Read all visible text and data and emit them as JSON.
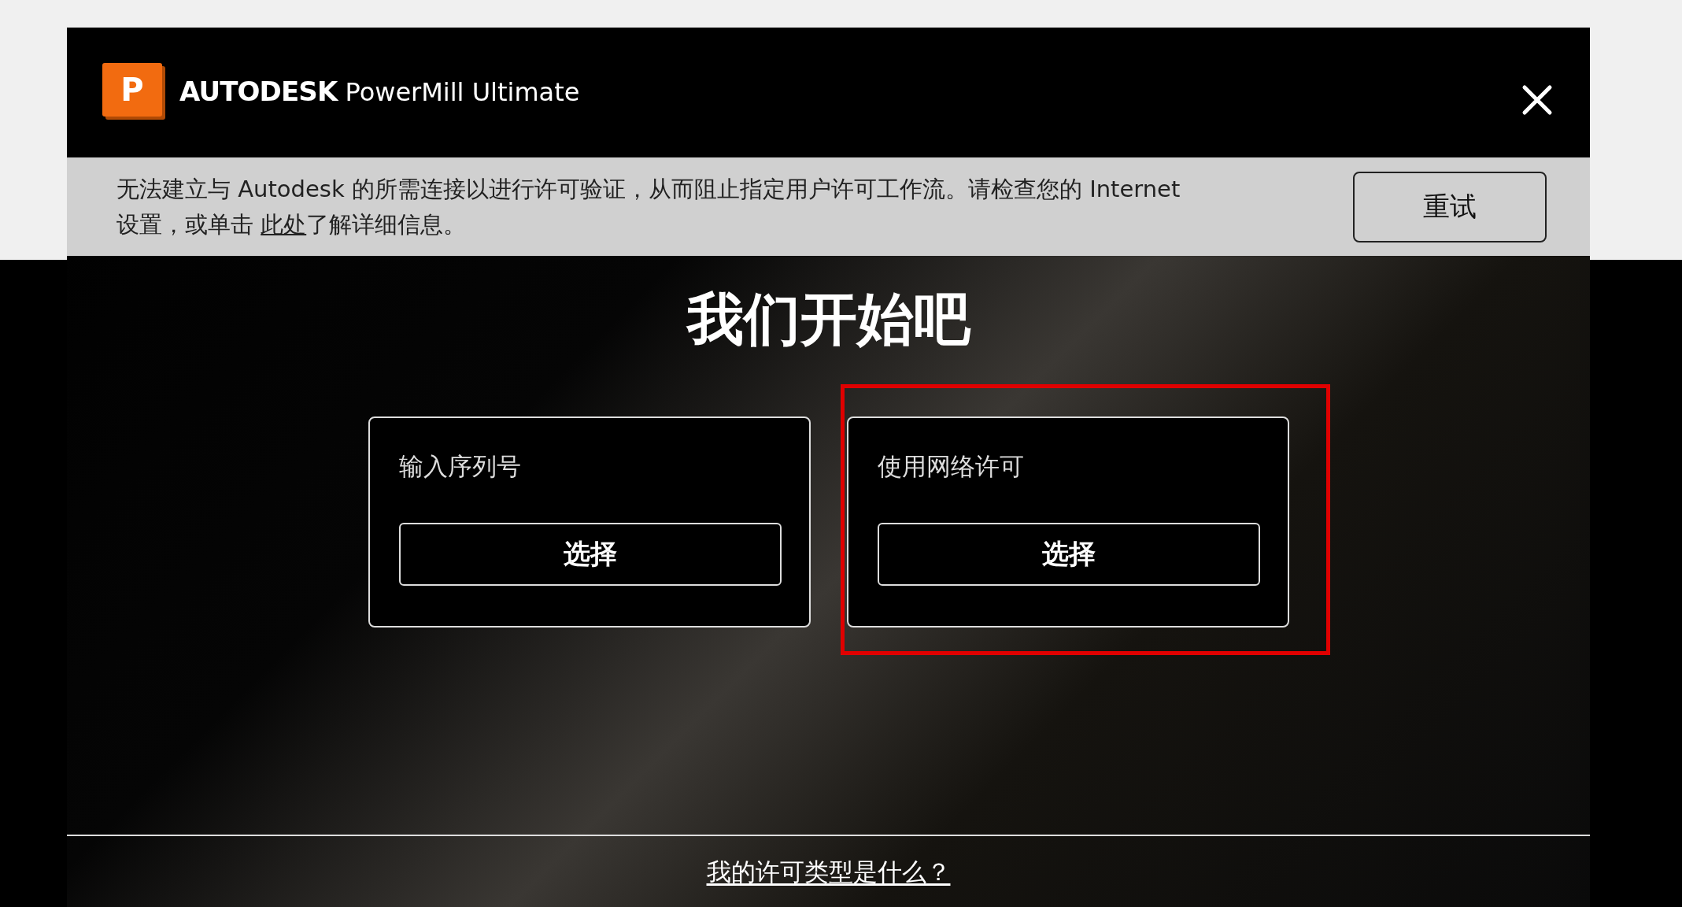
{
  "header": {
    "logo_letter": "P",
    "brand": "AUTODESK",
    "product": "PowerMill Ultimate"
  },
  "banner": {
    "message_before": "无法建立与 Autodesk 的所需连接以进行许可验证，从而阻止指定用户许可工作流。请检查您的 Internet 设置，或单击 ",
    "link": "此处",
    "message_after": "了解详细信息。",
    "button": "重试"
  },
  "title": "我们开始吧",
  "options": [
    {
      "label": "输入序列号",
      "button": "选择",
      "highlighted": false
    },
    {
      "label": "使用网络许可",
      "button": "选择",
      "highlighted": true
    }
  ],
  "footer_link": "我的许可类型是什么？"
}
